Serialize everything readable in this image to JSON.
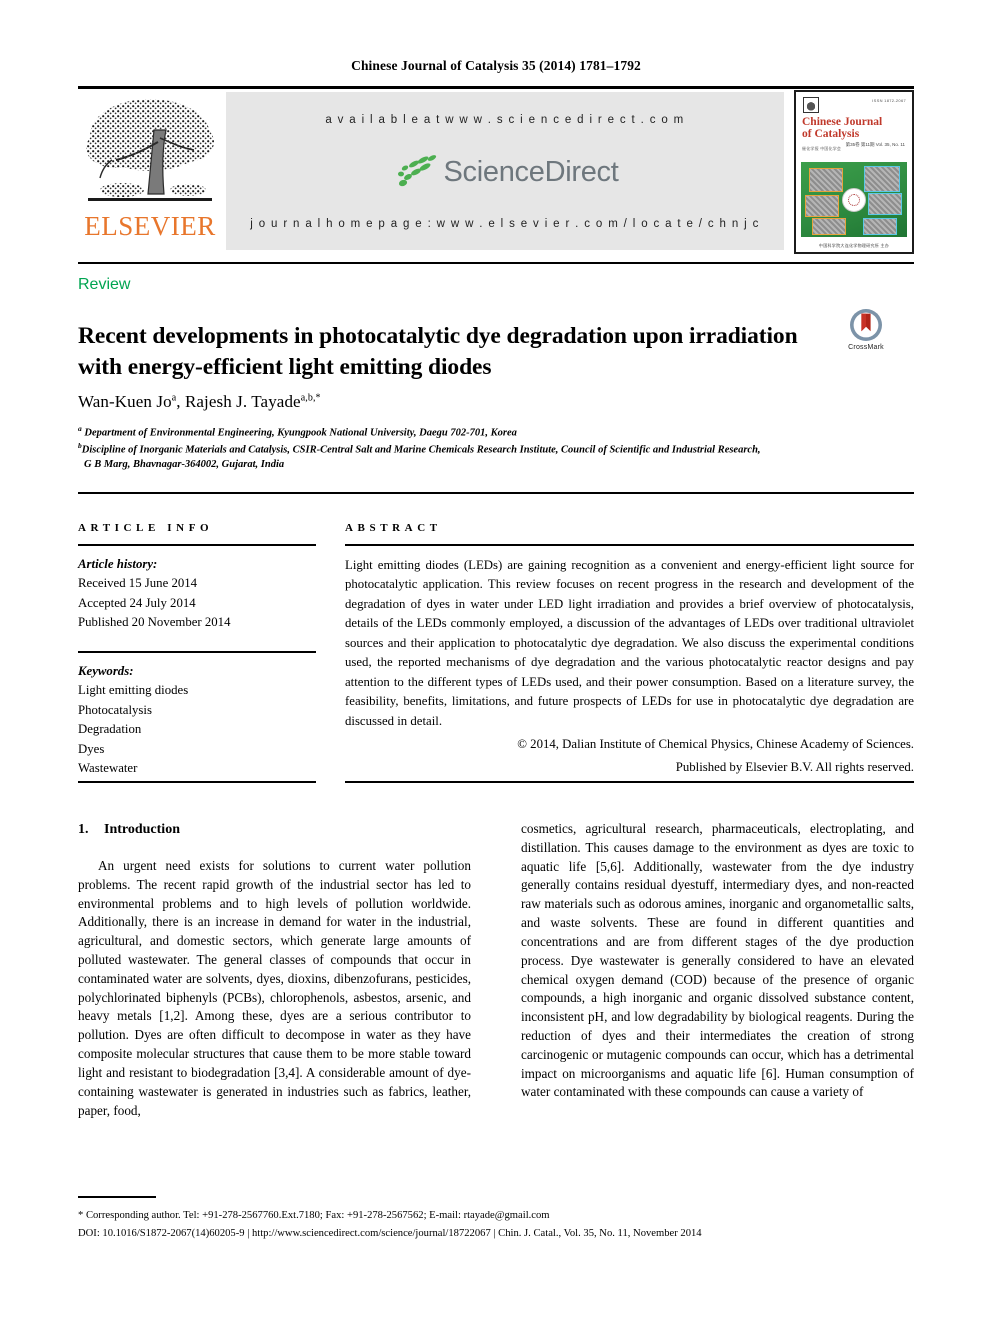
{
  "running_head": "Chinese Journal of Catalysis 35 (2014) 1781–1792",
  "header": {
    "publisher_name": "ELSEVIER",
    "available_at": "a v a i l a b l e   a t   w w w . s c i e n c e d i r e c t . c o m",
    "sciencedirect_word": "ScienceDirect",
    "journal_homepage": "j o u r n a l   h o m e p a g e :   w w w . e l s e v i e r . c o m / l o c a t e / c h n j c",
    "cover": {
      "title_line1": "Chinese Journal",
      "title_line2": "of Catalysis",
      "issn": "ISSN 1872-2067",
      "subtitle": "催化学报  中国化学会",
      "volume": "第35卷  第11期\nVol. 35, No. 11",
      "footer": "中国科学院大连化学物理研究所 主办"
    },
    "colors": {
      "elsevier_orange": "#E8762C",
      "sciencedirect_green": "#4CAF50",
      "sciencedirect_gray": "#6E777D",
      "band_gray": "#E6E6E6"
    }
  },
  "article": {
    "type": "Review",
    "type_color": "#00A551",
    "title": "Recent developments in photocatalytic dye degradation upon irradiation with energy-efficient light emitting diodes",
    "crossmark_label": "CrossMark",
    "authors_plain": "Wan-Kuen Jo",
    "authors": [
      {
        "name": "Wan-Kuen Jo",
        "sup": "a"
      },
      {
        "name": "Rajesh J. Tayade",
        "sup": "a,b,*"
      }
    ],
    "affiliations": [
      {
        "sup": "a",
        "text": "Department of Environmental Engineering, Kyungpook National University, Daegu 702-701, Korea"
      },
      {
        "sup": "b",
        "text": "Discipline of Inorganic Materials and Catalysis, CSIR-Central Salt and Marine Chemicals Research Institute, Council of Scientific and Industrial Research,"
      },
      {
        "sup": "",
        "text": "G B Marg, Bhavnagar-364002, Gujarat, India"
      }
    ]
  },
  "article_info": {
    "label": "ARTICLE INFO",
    "history_label": "Article history:",
    "history": [
      "Received 15 June 2014",
      "Accepted 24 July 2014",
      "Published 20 November 2014"
    ],
    "keywords_label": "Keywords:",
    "keywords": [
      "Light emitting diodes",
      "Photocatalysis",
      "Degradation",
      "Dyes",
      "Wastewater"
    ]
  },
  "abstract": {
    "label": "ABSTRACT",
    "body": "Light emitting diodes (LEDs) are gaining recognition as a convenient and energy-efficient light source for photocatalytic application. This review focuses on recent progress in the research and development of the degradation of dyes in water under LED light irradiation and provides a brief overview of photocatalysis, details of the LEDs commonly employed, a discussion of the advantages of LEDs over traditional ultraviolet sources and their application to photocatalytic dye degradation. We also discuss the experimental conditions used, the reported mechanisms of dye degradation and the various photocatalytic reactor designs and pay attention to the different types of LEDs used, and their power consumption. Based on a literature survey, the feasibility, benefits, limitations, and future prospects of LEDs for use in photocatalytic dye degradation are discussed in detail.",
    "copyright_line1": "© 2014, Dalian Institute of Chemical Physics, Chinese Academy of Sciences.",
    "copyright_line2": "Published by Elsevier B.V. All rights reserved."
  },
  "body": {
    "section_number": "1.",
    "section_title": "Introduction",
    "left_paragraph": "An urgent need exists for solutions to current water pollution problems. The recent rapid growth of the industrial sector has led to environmental problems and to high levels of pollution worldwide. Additionally, there is an increase in demand for water in the industrial, agricultural, and domestic sectors, which generate large amounts of polluted wastewater. The general classes of compounds that occur in contaminated water are solvents, dyes, dioxins, dibenzofurans, pesticides, polychlorinated biphenyls (PCBs), chlorophenols, asbestos, arsenic, and heavy metals [1,2]. Among these, dyes are a serious contributor to pollution. Dyes are often difficult to decompose in water as they have composite molecular structures that cause them to be more stable toward light and resistant to biodegradation [3,4]. A considerable amount of dye-containing wastewater is generated in industries such as fabrics, leather, paper, food,",
    "right_paragraph": "cosmetics, agricultural research, pharmaceuticals, electroplating, and distillation. This causes damage to the environment as dyes are toxic to aquatic life [5,6]. Additionally, wastewater from the dye industry generally contains residual dyestuff, intermediary dyes, and non-reacted raw materials such as odorous amines, inorganic and organometallic salts, and waste solvents. These are found in different quantities and concentrations and are from different stages of the dye production process. Dye wastewater is generally considered to have an elevated chemical oxygen demand (COD) because of the presence of organic compounds, a high inorganic and organic dissolved substance content, inconsistent pH, and low degradability by biological reagents. During the reduction of dyes and their intermediates the creation of strong carcinogenic or mutagenic compounds can occur, which has a detrimental impact on microorganisms and aquatic life [6]. Human consumption of water contaminated with these compounds can cause a variety of"
  },
  "footer": {
    "corresponding": "* Corresponding author. Tel: +91-278-2567760.Ext.7180; Fax: +91-278-2567562; E-mail: rtayade@gmail.com",
    "doi_line": "DOI: 10.1016/S1872-2067(14)60205-9 | http://www.sciencedirect.com/science/journal/18722067 | Chin. J. Catal., Vol. 35, No. 11, November 2014"
  }
}
